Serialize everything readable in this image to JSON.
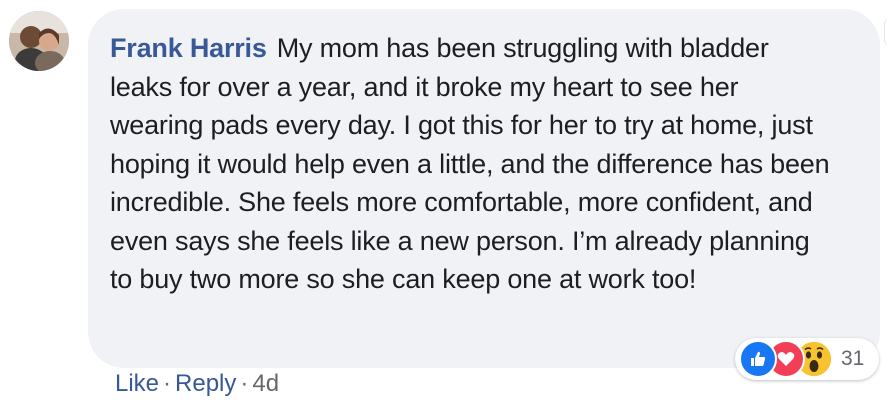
{
  "comment": {
    "author": "Frank Harris",
    "text": "My mom has been struggling with bladder leaks for over a year, and it broke my heart to see her wearing pads every day. I got this for her to try at home, just hoping it would help even a little, and the difference has been incredible. She feels more comfortable, more confident, and even says she feels like a new person. I’m already planning to buy two more so she can keep one at work too!"
  },
  "reactions": {
    "icons": [
      "like-icon",
      "love-icon",
      "wow-icon"
    ],
    "count": "31",
    "colors": {
      "like": "#1877f2",
      "love": "#f33e58",
      "wow": "#f7b125"
    }
  },
  "actions": {
    "like": "Like",
    "separator": "·",
    "reply": "Reply",
    "time": "4d"
  },
  "colors": {
    "bubble": "#f0f2f5",
    "author": "#385898",
    "text": "#1c1e21",
    "meta": "#65676b"
  }
}
